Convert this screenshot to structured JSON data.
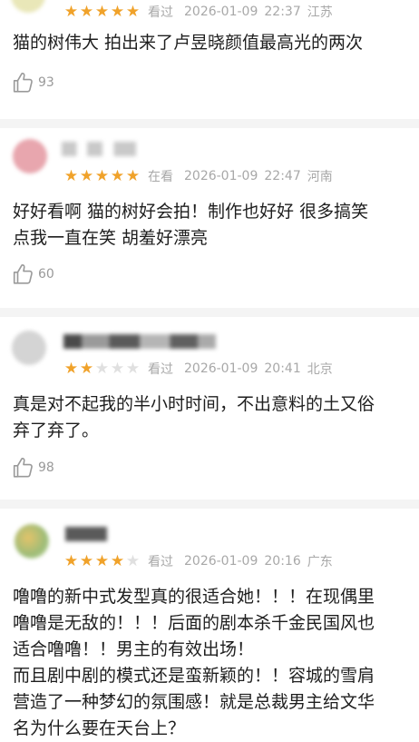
{
  "comments": [
    {
      "rating": 5,
      "status": "看过",
      "date": "2026-01-09",
      "time": "22:37",
      "location": "江苏",
      "lines": [
        "猫的树伟大 拍出来了卢昱晓颜值最高光的两次"
      ],
      "likes": "93",
      "avatar_color": "#e9e7b8"
    },
    {
      "rating": 5,
      "status": "在看",
      "date": "2026-01-09",
      "time": "22:47",
      "location": "河南",
      "lines": [
        "好好看啊 猫的树好会拍！制作也好好 很多搞笑",
        "点我一直在笑 胡羞好漂亮"
      ],
      "likes": "60",
      "avatar_color": "#e8a6ae"
    },
    {
      "rating": 2,
      "status": "看过",
      "date": "2026-01-09",
      "time": "20:41",
      "location": "北京",
      "lines": [
        "真是对不起我的半小时时间，不出意料的土又俗",
        "弃了弃了。"
      ],
      "likes": "98",
      "avatar_color": "#d4d4d4"
    },
    {
      "rating": 4,
      "status": "看过",
      "date": "2026-01-09",
      "time": "20:16",
      "location": "广东",
      "lines": [
        "噜噜的新中式发型真的很适合她！！！在现偶里",
        "噜噜是无敌的！！！后面的剧本杀千金民国风也",
        "适合噜噜！！男主的有效出场！",
        "而且剧中剧的模式还是蛮新颖的！！容城的雪肩",
        "营造了一种梦幻的氛围感！就是总裁男主给文华",
        "名为什么要在天台上？"
      ],
      "likes": "",
      "avatar_color": "#b9c98e"
    }
  ],
  "colors": {
    "star_on": "#f0a22a",
    "star_off": "#e0e0e0",
    "meta_text": "#a8a8a8",
    "separator": "#f4f4f4"
  },
  "icons": {
    "like": "thumb-up-outline-icon",
    "star": "star-icon"
  }
}
